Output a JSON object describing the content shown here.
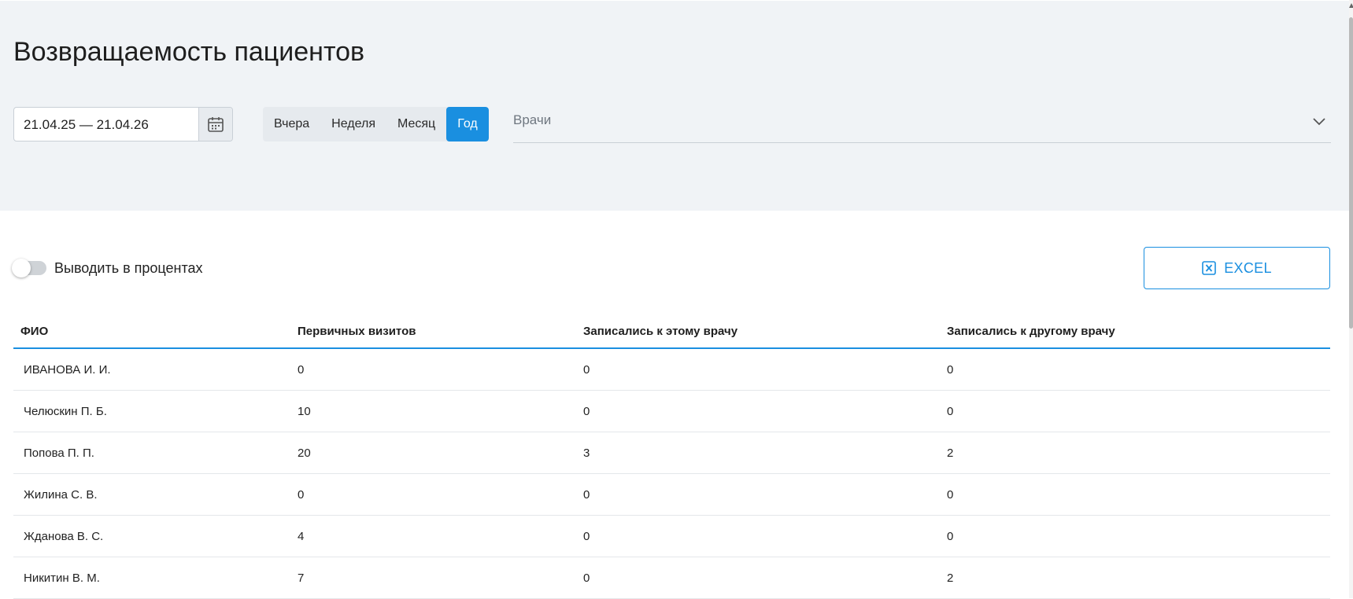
{
  "page": {
    "title": "Возвращаемость пациентов"
  },
  "filters": {
    "date_range": "21.04.25 — 21.04.26",
    "calendar_icon": "calendar-icon",
    "periods": [
      "Вчера",
      "Неделя",
      "Месяц",
      "Год"
    ],
    "active_period": "Год",
    "doctors_placeholder": "Врачи",
    "doctors_icon": "chevron-down-icon"
  },
  "controls": {
    "percent_toggle_label": "Выводить в процентах",
    "percent_toggle_on": false,
    "excel_label": "EXCEL",
    "excel_icon": "excel-icon"
  },
  "table": {
    "headers": [
      "ФИО",
      "Первичных визитов",
      "Записались к этому врачу",
      "Записались к другому врачу"
    ],
    "rows": [
      [
        "ИВАНОВА И. И.",
        "0",
        "0",
        "0"
      ],
      [
        "Челюскин П. Б.",
        "10",
        "0",
        "0"
      ],
      [
        "Попова П. П.",
        "20",
        "3",
        "2"
      ],
      [
        "Жилина  С. В.",
        "0",
        "0",
        "0"
      ],
      [
        "Жданова В. С.",
        "4",
        "0",
        "0"
      ],
      [
        "Никитин В. М.",
        "7",
        "0",
        "2"
      ]
    ]
  },
  "colors": {
    "accent": "#1a8fe0",
    "panel": "#f0f3f6"
  }
}
